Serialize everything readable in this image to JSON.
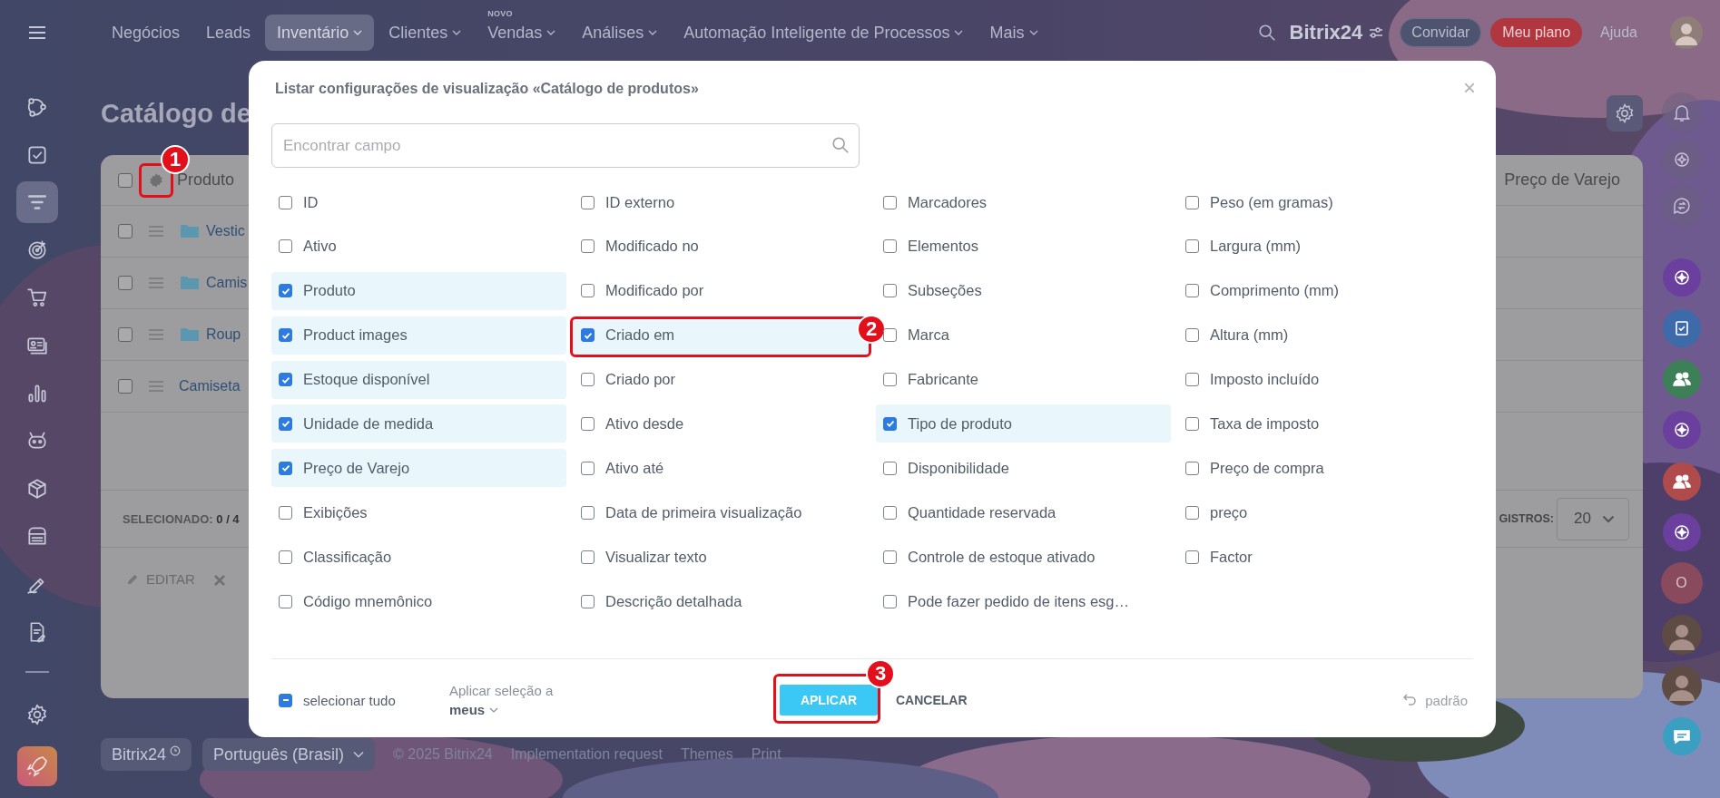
{
  "top_bar": {
    "nav": [
      {
        "label": "Negócios",
        "selected": false,
        "dropdown": false
      },
      {
        "label": "Leads",
        "selected": false,
        "dropdown": false
      },
      {
        "label": "Inventário",
        "selected": true,
        "dropdown": true
      },
      {
        "label": "Clientes",
        "selected": false,
        "dropdown": true
      },
      {
        "label": "Vendas",
        "selected": false,
        "dropdown": true,
        "badge": "NOVO"
      },
      {
        "label": "Análises",
        "selected": false,
        "dropdown": true
      },
      {
        "label": "Automação Inteligente de Processos",
        "selected": false,
        "dropdown": true
      },
      {
        "label": "Mais",
        "selected": false,
        "dropdown": true
      }
    ],
    "logo": "Bitrix24",
    "invite": "Convidar",
    "plan": "Meu plano",
    "help": "Ajuda"
  },
  "sidebar": {
    "items": [
      {
        "selected": false
      },
      {
        "selected": false
      },
      {
        "selected": true
      },
      {
        "selected": false
      },
      {
        "selected": false
      },
      {
        "selected": false
      },
      {
        "selected": false
      },
      {
        "selected": false
      },
      {
        "selected": false
      },
      {
        "selected": false
      },
      {
        "selected": false
      },
      {
        "selected": false
      }
    ]
  },
  "page": {
    "title": "Catálogo de",
    "table": {
      "header": {
        "label": "Produto",
        "checked": false,
        "callout": "1"
      },
      "last_column": "Preço de Varejo",
      "rows": [
        {
          "name": "Vestic",
          "kind": "folder",
          "checked": false
        },
        {
          "name": "Camis",
          "kind": "folder",
          "checked": false
        },
        {
          "name": "Roup",
          "kind": "folder",
          "checked": false
        },
        {
          "name": "Camiseta",
          "kind": "product",
          "checked": false
        }
      ],
      "selected_label": "SELECIONADO:",
      "selected_count": "0 / 4",
      "records_label": "GISTROS:",
      "records_value": "20",
      "actions": [
        {
          "kind": "edit",
          "label": "EDITAR"
        },
        {
          "kind": "delete"
        }
      ]
    }
  },
  "footer": {
    "brand": "Bitrix24",
    "language": "Português (Brasil)",
    "copyright": "© 2025 Bitrix24",
    "links": [
      "Implementation request",
      "Themes",
      "Print"
    ]
  },
  "rail": [
    {
      "kind": "icon"
    },
    {
      "kind": "icon"
    },
    {
      "kind": "icon"
    },
    {
      "kind": "app",
      "color": "#6a3f9e"
    },
    {
      "kind": "app",
      "color": "#3d6aa8"
    },
    {
      "kind": "app",
      "color": "#3d7f57"
    },
    {
      "kind": "app",
      "color": "#6a3f9e"
    },
    {
      "kind": "app",
      "color": "#b04b4b"
    },
    {
      "kind": "app",
      "color": "#6a3f9e"
    },
    {
      "kind": "letter",
      "text": "O",
      "color": "#8a4a5e"
    },
    {
      "kind": "avatar"
    },
    {
      "kind": "avatar"
    },
    {
      "kind": "app",
      "color": "#3b9fc2"
    }
  ],
  "dialog": {
    "title": "Listar configurações de visualização «Catálogo de produtos»",
    "close": "×",
    "search": {
      "placeholder": "Encontrar campo"
    },
    "fields": [
      {
        "label": "ID",
        "checked": false
      },
      {
        "label": "ID externo",
        "checked": false
      },
      {
        "label": "Marcadores",
        "checked": false
      },
      {
        "label": "Peso (em gramas)",
        "checked": false
      },
      {
        "label": "Ativo",
        "checked": false
      },
      {
        "label": "Modificado no",
        "checked": false
      },
      {
        "label": "Elementos",
        "checked": false
      },
      {
        "label": "Largura (mm)",
        "checked": false
      },
      {
        "label": "Produto",
        "checked": true
      },
      {
        "label": "Modificado por",
        "checked": false
      },
      {
        "label": "Subseções",
        "checked": false
      },
      {
        "label": "Comprimento (mm)",
        "checked": false
      },
      {
        "label": "Product images",
        "checked": true
      },
      {
        "label": "Criado em",
        "checked": true,
        "callout": "2"
      },
      {
        "label": "Marca",
        "checked": false
      },
      {
        "label": "Altura (mm)",
        "checked": false
      },
      {
        "label": "Estoque disponível",
        "checked": true
      },
      {
        "label": "Criado por",
        "checked": false
      },
      {
        "label": "Fabricante",
        "checked": false
      },
      {
        "label": "Imposto incluído",
        "checked": false
      },
      {
        "label": "Unidade de medida",
        "checked": true
      },
      {
        "label": "Ativo desde",
        "checked": false
      },
      {
        "label": "Tipo de produto",
        "checked": true
      },
      {
        "label": "Taxa de imposto",
        "checked": false
      },
      {
        "label": "Preço de Varejo",
        "checked": true
      },
      {
        "label": "Ativo até",
        "checked": false
      },
      {
        "label": "Disponibilidade",
        "checked": false
      },
      {
        "label": "Preço de compra",
        "checked": false
      },
      {
        "label": "Exibições",
        "checked": false
      },
      {
        "label": "Data de primeira visualização",
        "checked": false
      },
      {
        "label": "Quantidade reservada",
        "checked": false
      },
      {
        "label": "preço",
        "checked": false
      },
      {
        "label": "Classificação",
        "checked": false
      },
      {
        "label": "Visualizar texto",
        "checked": false
      },
      {
        "label": "Controle de estoque ativado",
        "checked": false
      },
      {
        "label": "Factor",
        "checked": false
      },
      {
        "label": "Código mnemônico",
        "checked": false
      },
      {
        "label": "Descrição detalhada",
        "checked": false
      },
      {
        "label": "Pode fazer pedido de itens esg…",
        "checked": false
      }
    ],
    "select_all": {
      "label": "selecionar tudo",
      "indeterminate": true
    },
    "apply_to": {
      "label": "Aplicar seleção a",
      "value": "meus"
    },
    "apply": {
      "label": "APLICAR",
      "callout": "3"
    },
    "cancel": "CANCELAR",
    "reset": "padrão"
  }
}
